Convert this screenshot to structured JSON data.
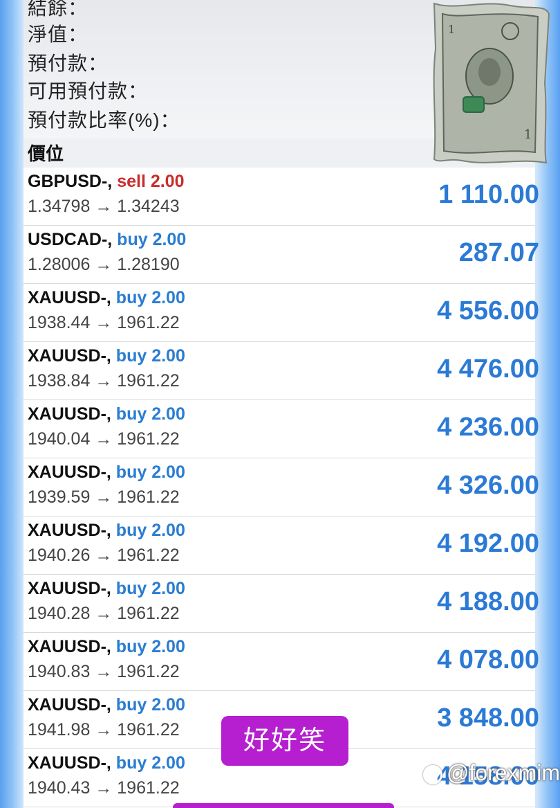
{
  "summary": {
    "rows": [
      "結餘：",
      "淨值：",
      "預付款：",
      "可用預付款：",
      "預付款比率(%)："
    ]
  },
  "section": {
    "title": "價位"
  },
  "positions": [
    {
      "symbol": "GBPUSD-,",
      "side": "sell 2.00",
      "prices": "1.34798 → 1.34243",
      "profit": "1 110.00"
    },
    {
      "symbol": "USDCAD-,",
      "side": "buy 2.00",
      "prices": "1.28006 → 1.28190",
      "profit": "287.07"
    },
    {
      "symbol": "XAUUSD-,",
      "side": "buy 2.00",
      "prices": "1938.44 → 1961.22",
      "profit": "4 556.00"
    },
    {
      "symbol": "XAUUSD-,",
      "side": "buy 2.00",
      "prices": "1938.84 → 1961.22",
      "profit": "4 476.00"
    },
    {
      "symbol": "XAUUSD-,",
      "side": "buy 2.00",
      "prices": "1940.04 → 1961.22",
      "profit": "4 236.00"
    },
    {
      "symbol": "XAUUSD-,",
      "side": "buy 2.00",
      "prices": "1939.59 → 1961.22",
      "profit": "4 326.00"
    },
    {
      "symbol": "XAUUSD-,",
      "side": "buy 2.00",
      "prices": "1940.26 → 1961.22",
      "profit": "4 192.00"
    },
    {
      "symbol": "XAUUSD-,",
      "side": "buy 2.00",
      "prices": "1940.28 → 1961.22",
      "profit": "4 188.00"
    },
    {
      "symbol": "XAUUSD-,",
      "side": "buy 2.00",
      "prices": "1940.83 → 1961.22",
      "profit": "4 078.00"
    },
    {
      "symbol": "XAUUSD-,",
      "side": "buy 2.00",
      "prices": "1941.98 → 1961.22",
      "profit": "3 848.00"
    },
    {
      "symbol": "XAUUSD-,",
      "side": "buy 2.00",
      "prices": "1940.43 → 1961.22",
      "profit": "4 158.00"
    }
  ],
  "caption": "好好笑",
  "watermark": "@forexmimi",
  "colors": {
    "sell": "#cc2b2b",
    "buy": "#2a7dd1",
    "profit": "#2b7ad6",
    "badge": "#b51fcf"
  },
  "icons": {
    "decoration": "dollar-bill-icon",
    "watermark": "social-logo-icon"
  }
}
